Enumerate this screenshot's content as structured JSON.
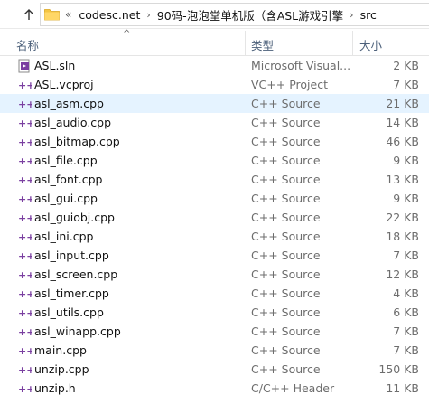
{
  "address": {
    "overflow_glyph": "«",
    "separator": "›",
    "segments": [
      "codesc.net",
      "90码-泡泡堂单机版（含ASL游戏引擎",
      "src"
    ]
  },
  "columns": {
    "name": "名称",
    "type": "类型",
    "size": "大小",
    "sort_indicator": "^"
  },
  "files": [
    {
      "name": "ASL.sln",
      "type": "Microsoft Visual...",
      "size": "2 KB",
      "icon": "solution-file-icon",
      "selected": false
    },
    {
      "name": "ASL.vcproj",
      "type": "VC++ Project",
      "size": "7 KB",
      "icon": "vcproj-file-icon",
      "selected": false
    },
    {
      "name": "asl_asm.cpp",
      "type": "C++ Source",
      "size": "21 KB",
      "icon": "cpp-file-icon",
      "selected": true
    },
    {
      "name": "asl_audio.cpp",
      "type": "C++ Source",
      "size": "14 KB",
      "icon": "cpp-file-icon",
      "selected": false
    },
    {
      "name": "asl_bitmap.cpp",
      "type": "C++ Source",
      "size": "46 KB",
      "icon": "cpp-file-icon",
      "selected": false
    },
    {
      "name": "asl_file.cpp",
      "type": "C++ Source",
      "size": "9 KB",
      "icon": "cpp-file-icon",
      "selected": false
    },
    {
      "name": "asl_font.cpp",
      "type": "C++ Source",
      "size": "13 KB",
      "icon": "cpp-file-icon",
      "selected": false
    },
    {
      "name": "asl_gui.cpp",
      "type": "C++ Source",
      "size": "9 KB",
      "icon": "cpp-file-icon",
      "selected": false
    },
    {
      "name": "asl_guiobj.cpp",
      "type": "C++ Source",
      "size": "22 KB",
      "icon": "cpp-file-icon",
      "selected": false
    },
    {
      "name": "asl_ini.cpp",
      "type": "C++ Source",
      "size": "18 KB",
      "icon": "cpp-file-icon",
      "selected": false
    },
    {
      "name": "asl_input.cpp",
      "type": "C++ Source",
      "size": "7 KB",
      "icon": "cpp-file-icon",
      "selected": false
    },
    {
      "name": "asl_screen.cpp",
      "type": "C++ Source",
      "size": "12 KB",
      "icon": "cpp-file-icon",
      "selected": false
    },
    {
      "name": "asl_timer.cpp",
      "type": "C++ Source",
      "size": "4 KB",
      "icon": "cpp-file-icon",
      "selected": false
    },
    {
      "name": "asl_utils.cpp",
      "type": "C++ Source",
      "size": "6 KB",
      "icon": "cpp-file-icon",
      "selected": false
    },
    {
      "name": "asl_winapp.cpp",
      "type": "C++ Source",
      "size": "7 KB",
      "icon": "cpp-file-icon",
      "selected": false
    },
    {
      "name": "main.cpp",
      "type": "C++ Source",
      "size": "7 KB",
      "icon": "cpp-file-icon",
      "selected": false
    },
    {
      "name": "unzip.cpp",
      "type": "C++ Source",
      "size": "150 KB",
      "icon": "cpp-file-icon",
      "selected": false
    },
    {
      "name": "unzip.h",
      "type": "C/C++ Header",
      "size": "11 KB",
      "icon": "header-file-icon",
      "selected": false
    }
  ],
  "colors": {
    "selected_row": "#e5f3ff",
    "header_text": "#4c607a",
    "cpp_icon": "#7a3fa0",
    "folder": "#f4c542"
  }
}
